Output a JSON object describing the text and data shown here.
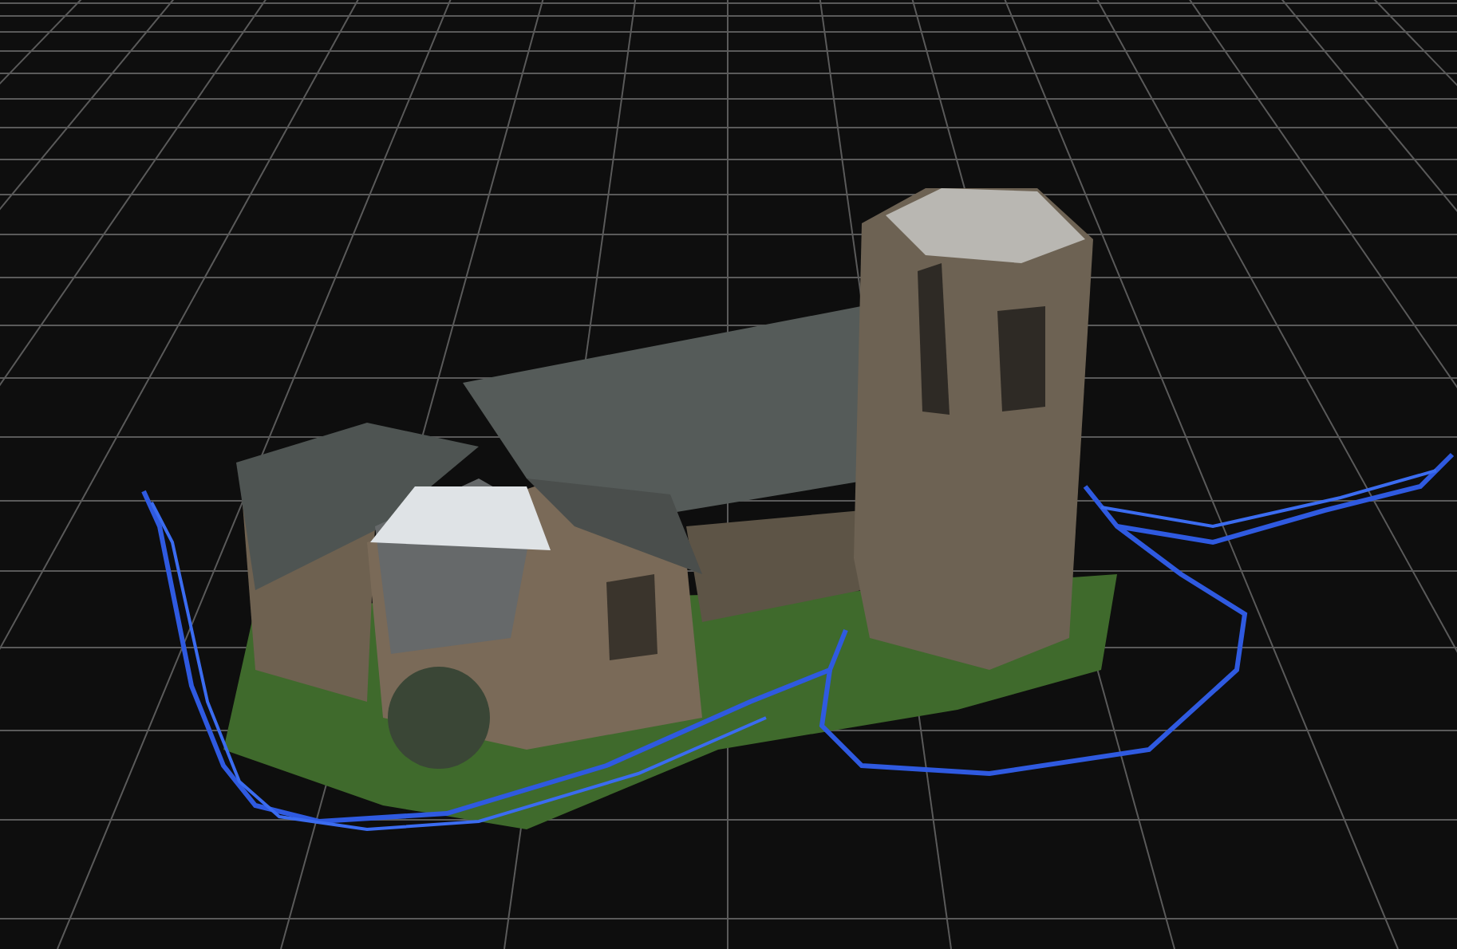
{
  "viewport": {
    "grid": true,
    "camera_path": true
  }
}
